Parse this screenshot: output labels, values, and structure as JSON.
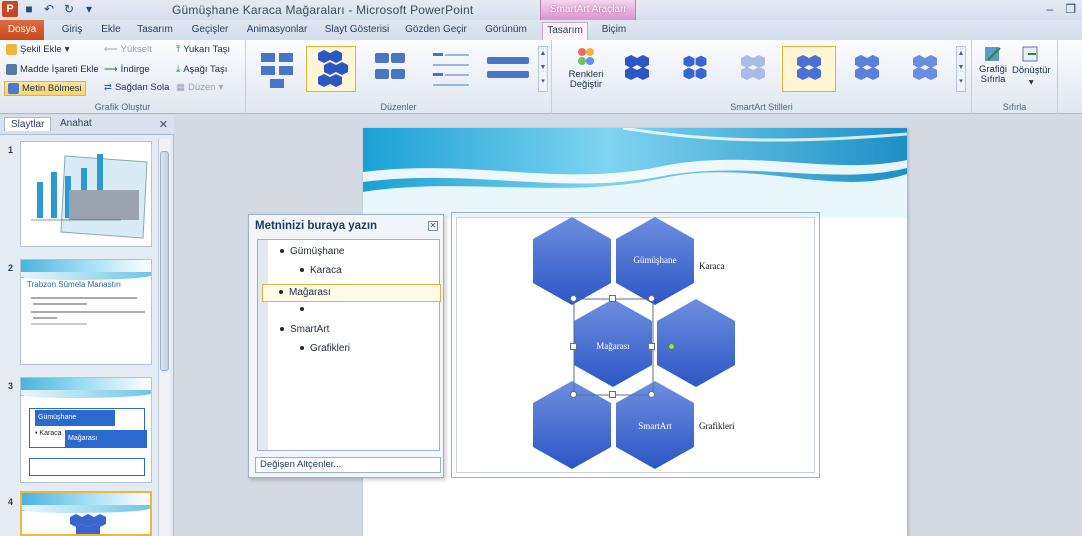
{
  "window": {
    "title": "Gümüşhane Karaca Mağaraları - Microsoft PowerPoint",
    "context_tab_header": "SmartArt Araçları"
  },
  "tabs": [
    {
      "label": "Dosya"
    },
    {
      "label": "Giriş"
    },
    {
      "label": "Ekle"
    },
    {
      "label": "Tasarım"
    },
    {
      "label": "Geçişler"
    },
    {
      "label": "Animasyonlar"
    },
    {
      "label": "Slayt Gösterisi"
    },
    {
      "label": "Gözden Geçir"
    },
    {
      "label": "Görünüm"
    },
    {
      "label": "Tasarım"
    },
    {
      "label": "Biçim"
    }
  ],
  "ribbon": {
    "create_graphic": {
      "label": "Grafik Oluştur",
      "add_shape": "Şekil Ekle",
      "add_bullet": "Madde İşareti Ekle",
      "text_pane": "Metin Bölmesi",
      "promote": "Yükselt",
      "demote": "İndirge",
      "right_to_left": "Sağdan Sola",
      "move_up": "Yukarı Taşı",
      "move_down": "Aşağı Taşı",
      "layout": "Düzen"
    },
    "layouts": {
      "label": "Düzenler"
    },
    "styles": {
      "label": "SmartArt Stilleri",
      "change_colors": "Renkleri Değiştir"
    },
    "reset": {
      "label": "Sıfırla",
      "reset_graphic": "Grafiği Sıfırla",
      "convert": "Dönüştür"
    }
  },
  "left_panel": {
    "tabs": [
      "Slaytlar",
      "Anahat"
    ],
    "slides": [
      {
        "number": "1"
      },
      {
        "number": "2",
        "title": "Trabzon Sümela Manastırı"
      },
      {
        "number": "3",
        "box1": "Gümüşhane",
        "bullet": "• Karaca",
        "box2": "Mağarası"
      },
      {
        "number": "4"
      }
    ]
  },
  "text_pane": {
    "title": "Metninizi buraya yazın",
    "items": [
      {
        "text": "Gümüşhane",
        "level": 1
      },
      {
        "text": "Karaca",
        "level": 2
      },
      {
        "text": "Mağarası",
        "level": 1
      },
      {
        "text": "",
        "level": 2
      },
      {
        "text": "SmartArt",
        "level": 1
      },
      {
        "text": "Grafikleri",
        "level": 2
      }
    ],
    "footer": "Değişen Altçenler..."
  },
  "smartart": {
    "hex1_label": "Gümüşhane",
    "hex1_side": "Karaca",
    "hex2_label": "Mağarası",
    "hex3_label": "SmartArt",
    "hex3_side": "Grafikleri"
  },
  "colors": {
    "hex_fill_top": "#6d8ee0",
    "hex_fill_bottom": "#2c56c4",
    "accent_orange": "#c84a1e",
    "context_pink": "#d894cf"
  }
}
